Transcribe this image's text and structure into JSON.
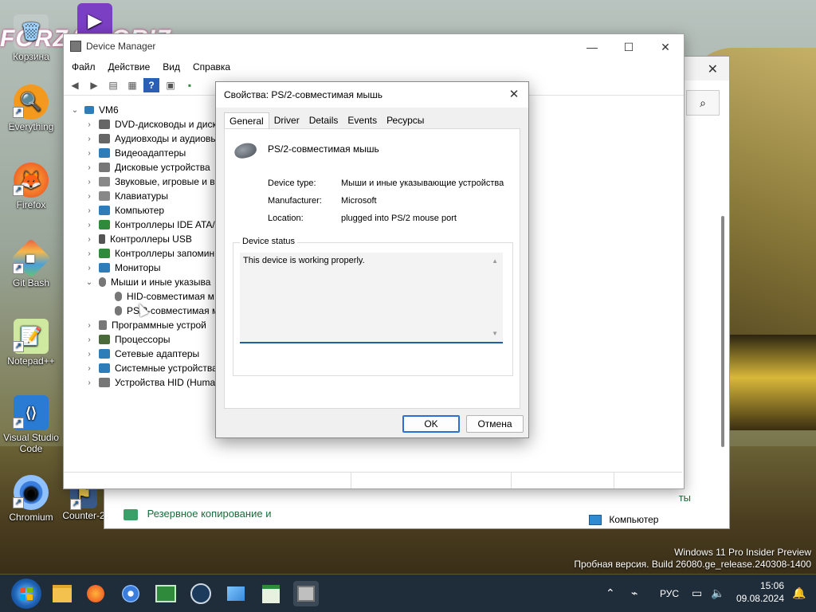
{
  "desktop": {
    "icons": [
      {
        "label": "Корзина",
        "color": "#3a9bd8",
        "glyph": "🗑"
      },
      {
        "label": "Everything",
        "color": "#f39a1e",
        "glyph": "🔍"
      },
      {
        "label": "Firefox",
        "color": "#e8662a",
        "glyph": "🦊"
      },
      {
        "label": "Git Bash",
        "color": "#e9573f",
        "glyph": "◆"
      },
      {
        "label": "Notepad++",
        "color": "#9ac93e",
        "glyph": "📝"
      },
      {
        "label": "Visual Studio Code",
        "color": "#2a7bd3",
        "glyph": "⟨⟩"
      },
      {
        "label": "Chromium",
        "color": "#3b7ddd",
        "glyph": "◉"
      },
      {
        "label": "Counter-2",
        "color": "#e8c24a",
        "glyph": "⚑"
      }
    ],
    "top_banner": "FORZA HORIZ"
  },
  "background_window": {
    "bottom_text": "Резервное копирование и",
    "bottom_right": "ты",
    "status": "Компьютер"
  },
  "device_manager": {
    "title": "Device Manager",
    "minimize": "—",
    "maximize": "☐",
    "close": "✕",
    "menu": [
      "Файл",
      "Действие",
      "Вид",
      "Справка"
    ],
    "tree": {
      "root": "VM6",
      "categories": [
        {
          "label": "DVD-дисководы и диск",
          "expanded": false,
          "icon_color": "#666"
        },
        {
          "label": "Аудиовходы и аудиовы",
          "expanded": false,
          "icon_color": "#666"
        },
        {
          "label": "Видеоадаптеры",
          "expanded": false,
          "icon_color": "#2f7db8"
        },
        {
          "label": "Дисковые устройства",
          "expanded": false,
          "icon_color": "#777"
        },
        {
          "label": "Звуковые, игровые и в",
          "expanded": false,
          "icon_color": "#888"
        },
        {
          "label": "Клавиатуры",
          "expanded": false,
          "icon_color": "#888"
        },
        {
          "label": "Компьютер",
          "expanded": false,
          "icon_color": "#2f7db8"
        },
        {
          "label": "Контроллеры IDE ATA/A",
          "expanded": false,
          "icon_color": "#2f8a3c"
        },
        {
          "label": "Контроллеры USB",
          "expanded": false,
          "icon_color": "#555"
        },
        {
          "label": "Контроллеры запомин",
          "expanded": false,
          "icon_color": "#2f8a3c"
        },
        {
          "label": "Мониторы",
          "expanded": false,
          "icon_color": "#2f7db8"
        },
        {
          "label": "Мыши и иные указыва",
          "expanded": true,
          "icon_color": "#777"
        },
        {
          "label": "HID-совместимая м",
          "child": true,
          "icon_color": "#777"
        },
        {
          "label": "PS/2-совместимая м",
          "child": true,
          "icon_color": "#777"
        },
        {
          "label": "Программные устрой",
          "expanded": false,
          "icon_color": "#777"
        },
        {
          "label": "Процессоры",
          "expanded": false,
          "icon_color": "#4a6a3a"
        },
        {
          "label": "Сетевые адаптеры",
          "expanded": false,
          "icon_color": "#2f7db8"
        },
        {
          "label": "Системные устройства",
          "expanded": false,
          "icon_color": "#2f7db8"
        },
        {
          "label": "Устройства HID (Human",
          "expanded": false,
          "icon_color": "#777"
        }
      ]
    }
  },
  "dialog": {
    "title": "Свойства: PS/2-совместимая мышь",
    "close": "✕",
    "tabs": [
      "General",
      "Driver",
      "Details",
      "Events",
      "Ресурсы"
    ],
    "active_tab": "General",
    "device_name": "PS/2-совместимая мышь",
    "props": [
      {
        "label": "Device type:",
        "value": "Мыши и иные указывающие устройства"
      },
      {
        "label": "Manufacturer:",
        "value": "Microsoft"
      },
      {
        "label": "Location:",
        "value": "plugged into PS/2 mouse port"
      }
    ],
    "status_group": "Device status",
    "status_text": "This device is working properly.",
    "ok": "OK",
    "cancel": "Отмена"
  },
  "watermark": {
    "line1": "Windows 11 Pro Insider Preview",
    "line2": "Пробная версия. Build 26080.ge_release.240308-1400"
  },
  "taskbar": {
    "lang": "РУС",
    "time": "15:06",
    "date": "09.08.2024"
  }
}
